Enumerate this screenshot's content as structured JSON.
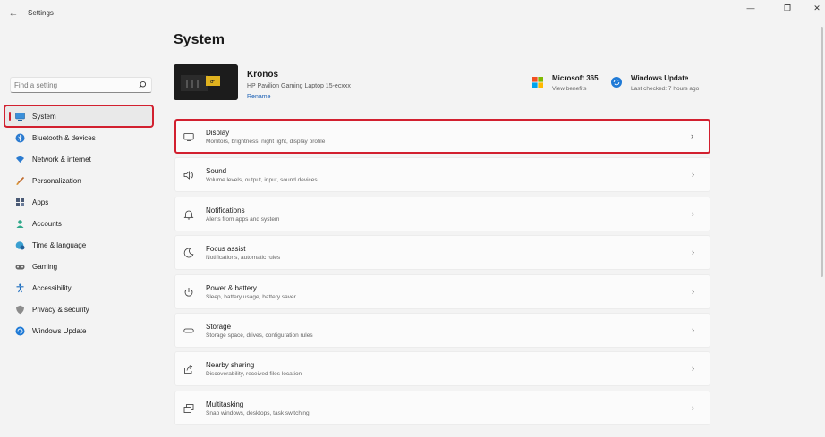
{
  "window": {
    "title": "Settings",
    "back_glyph": "←",
    "controls": {
      "minimize": "—",
      "maximize": "❐",
      "close": "✕"
    }
  },
  "sidebar": {
    "search_placeholder": "Find a setting",
    "items": [
      {
        "label": "System",
        "icon": "monitor-icon",
        "active": true
      },
      {
        "label": "Bluetooth & devices",
        "icon": "bluetooth-icon"
      },
      {
        "label": "Network & internet",
        "icon": "wifi-icon"
      },
      {
        "label": "Personalization",
        "icon": "brush-icon"
      },
      {
        "label": "Apps",
        "icon": "apps-icon"
      },
      {
        "label": "Accounts",
        "icon": "person-icon"
      },
      {
        "label": "Time & language",
        "icon": "globe-clock-icon"
      },
      {
        "label": "Gaming",
        "icon": "gamepad-icon"
      },
      {
        "label": "Accessibility",
        "icon": "accessibility-icon"
      },
      {
        "label": "Privacy & security",
        "icon": "shield-icon"
      },
      {
        "label": "Windows Update",
        "icon": "windows-update-icon"
      }
    ]
  },
  "main": {
    "title": "System",
    "device": {
      "name": "Kronos",
      "model": "HP Pavilion Gaming Laptop 15-ecxxx",
      "rename": "Rename"
    },
    "tiles": [
      {
        "title": "Microsoft 365",
        "subtitle": "View benefits",
        "icon": "microsoft-logo-icon"
      },
      {
        "title": "Windows Update",
        "subtitle": "Last checked: 7 hours ago",
        "icon": "refresh-icon"
      }
    ],
    "rows": [
      {
        "title": "Display",
        "subtitle": "Monitors, brightness, night light, display profile",
        "icon": "display-icon",
        "highlight": true
      },
      {
        "title": "Sound",
        "subtitle": "Volume levels, output, input, sound devices",
        "icon": "speaker-icon"
      },
      {
        "title": "Notifications",
        "subtitle": "Alerts from apps and system",
        "icon": "bell-icon"
      },
      {
        "title": "Focus assist",
        "subtitle": "Notifications, automatic rules",
        "icon": "moon-icon"
      },
      {
        "title": "Power & battery",
        "subtitle": "Sleep, battery usage, battery saver",
        "icon": "power-icon"
      },
      {
        "title": "Storage",
        "subtitle": "Storage space, drives, configuration rules",
        "icon": "storage-icon"
      },
      {
        "title": "Nearby sharing",
        "subtitle": "Discoverability, received files location",
        "icon": "share-icon"
      },
      {
        "title": "Multitasking",
        "subtitle": "Snap windows, desktops, task switching",
        "icon": "multitask-icon"
      }
    ],
    "chevron": "›"
  },
  "colors": {
    "highlight": "#d2202f",
    "accent": "#0067c0"
  }
}
